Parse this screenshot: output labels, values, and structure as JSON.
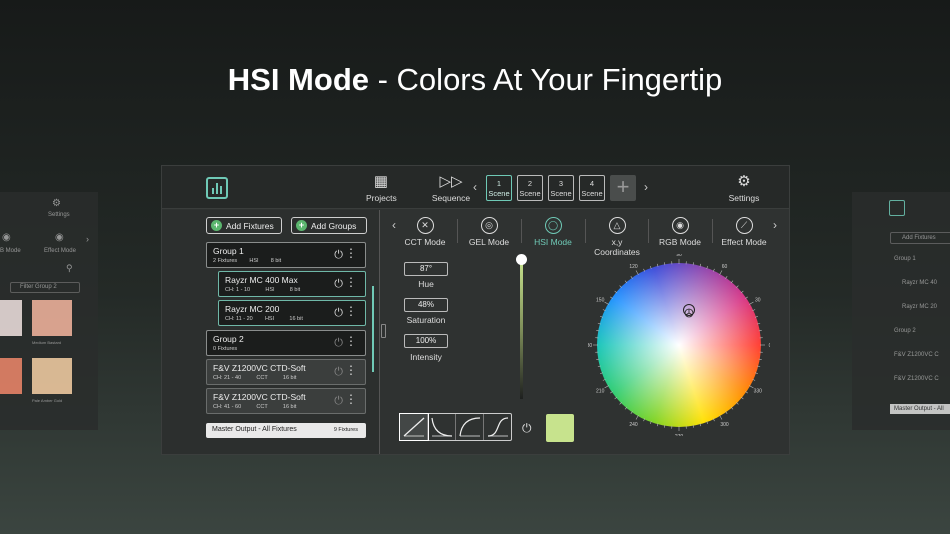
{
  "headline": {
    "bold": "HSI Mode",
    "rest": " - Colors At Your Fingertip"
  },
  "topbar": {
    "projects_label": "Projects",
    "sequence_label": "Sequence",
    "settings_label": "Settings",
    "scenes": [
      {
        "num": "1",
        "label": "Scene",
        "active": true
      },
      {
        "num": "2",
        "label": "Scene",
        "active": false
      },
      {
        "num": "3",
        "label": "Scene",
        "active": false
      },
      {
        "num": "4",
        "label": "Scene",
        "active": false
      }
    ]
  },
  "left_panel": {
    "add_fixtures": "Add Fixtures",
    "add_groups": "Add Groups",
    "rows": [
      {
        "name": "Group 1",
        "meta": "2 Fixtures        HSI        8 bit"
      },
      {
        "name": "Rayzr MC 400 Max",
        "meta": "CH: 1 - 10          HSI          8 bit"
      },
      {
        "name": "Rayzr MC 200",
        "meta": "CH: 11 - 20        HSI          16 bit"
      },
      {
        "name": "Group 2",
        "meta": "0 Fixtures"
      },
      {
        "name": "F&V Z1200VC CTD-Soft",
        "meta": "CH: 21 - 40          CCT          16 bit"
      },
      {
        "name": "F&V Z1200VC CTD-Soft",
        "meta": "CH: 41 - 60          CCT          16 bit"
      }
    ],
    "master_label": "Master Output - All Fixtures",
    "master_count": "9 Fixtures"
  },
  "modes": [
    {
      "label": "CCT Mode",
      "icon": "cct-icon",
      "active": false
    },
    {
      "label": "GEL Mode",
      "icon": "gel-icon",
      "active": false
    },
    {
      "label": "HSI Mode",
      "icon": "hsi-icon",
      "active": true
    },
    {
      "label": "x,y Coordinates",
      "icon": "xy-icon",
      "active": false
    },
    {
      "label": "RGB Mode",
      "icon": "rgb-icon",
      "active": false
    },
    {
      "label": "Effect Mode",
      "icon": "effect-icon",
      "active": false
    }
  ],
  "values": {
    "hue": "87°",
    "hue_label": "Hue",
    "saturation": "48%",
    "saturation_label": "Saturation",
    "intensity": "100%",
    "intensity_label": "Intensity"
  },
  "intensity_level": 1.0,
  "swatch_color": "#c7e38d",
  "accent_color": "#6fc9b6",
  "wheel_ticks": [
    "0",
    "30",
    "60",
    "90",
    "120",
    "150",
    "180",
    "210",
    "240",
    "270",
    "300",
    "330"
  ],
  "ghost_left": {
    "settings_label": "Settings",
    "mode_a": "B Mode",
    "mode_b": "Effect Mode",
    "filter_label": "Filter Group 2",
    "tile_a": "Medium Bastard",
    "tile_b": "Pale Amber Gold"
  },
  "ghost_right": {
    "add_fixtures": "Add Fixtures",
    "rows": [
      "Group 1",
      "Rayzr MC 40",
      "Rayzr MC 20",
      "Group 2",
      "F&V Z1200VC C",
      "F&V Z1200VC C"
    ],
    "master": "Master Output - All"
  }
}
